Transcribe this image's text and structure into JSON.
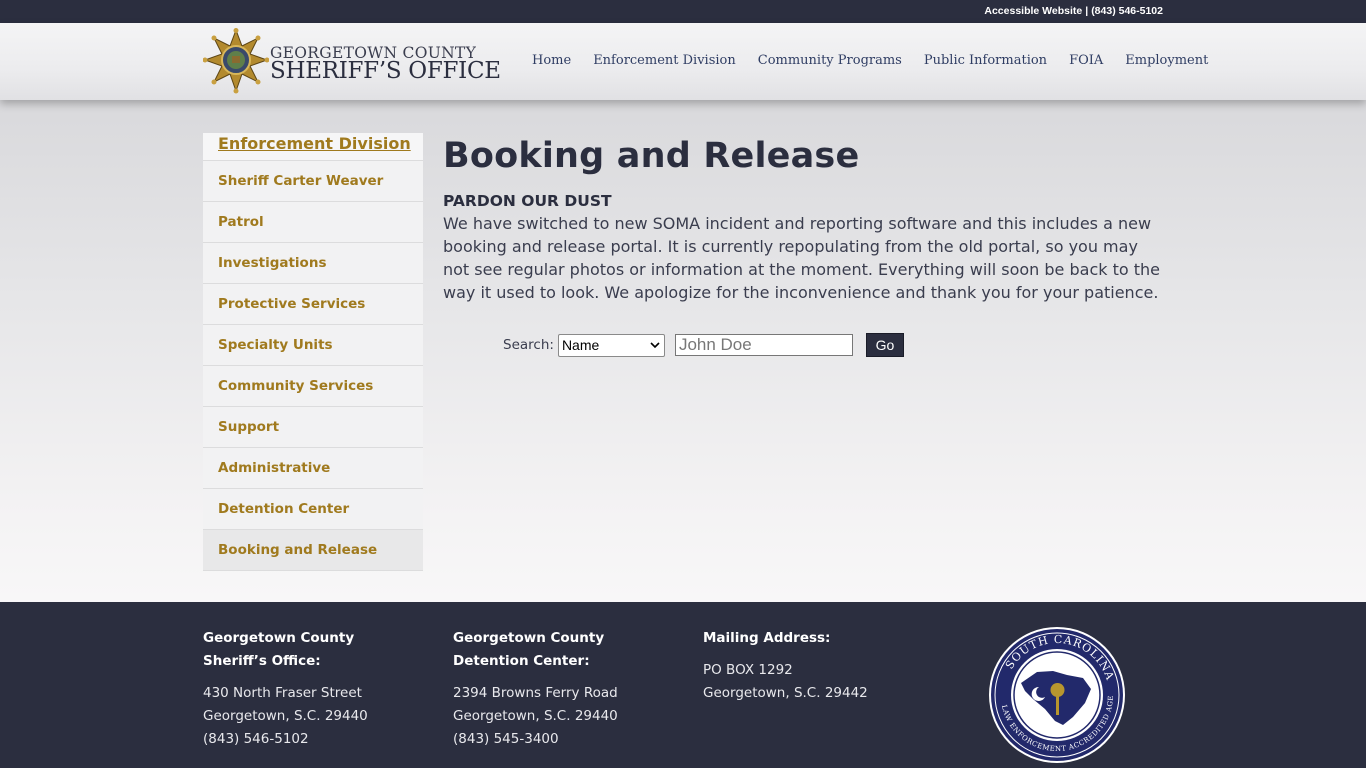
{
  "topbar": {
    "accessible": "Accessible Website",
    "separator": "|",
    "phone": "(843) 546-5102"
  },
  "header": {
    "logo_line1": "GEORGETOWN COUNTY",
    "logo_line2": "SHERIFF’S OFFICE",
    "logo_icon": "sheriff-star-badge",
    "nav": [
      "Home",
      "Enforcement Division",
      "Community Programs",
      "Public Information",
      "FOIA",
      "Employment"
    ]
  },
  "sidebar": {
    "title": "Enforcement Division",
    "items": [
      "Sheriff Carter Weaver",
      "Patrol",
      "Investigations",
      "Protective Services",
      "Specialty Units",
      "Community Services",
      "Support",
      "Administrative",
      "Detention Center",
      "Booking and Release"
    ],
    "active_item": "Booking and Release"
  },
  "main": {
    "title": "Booking and Release",
    "notice_heading": "PARDON OUR DUST",
    "notice_body": "We have switched to new SOMA incident and reporting software and this includes a new booking and release portal. It is currently repopulating from the old portal, so you may not see regular photos or information at the moment. Everything will soon be back to the way it used to look. We apologize for the inconvenience and thank you for your patience."
  },
  "search": {
    "label": "Search:",
    "select_value": "Name",
    "input_placeholder": "John Doe",
    "button": "Go"
  },
  "footer": {
    "office": {
      "heading": "Georgetown County Sheriff’s Office:",
      "line1": "430 North Fraser Street",
      "line2": "Georgetown, S.C. 29440",
      "line3": "(843) 546-5102"
    },
    "detention": {
      "heading": "Georgetown County Detention Center:",
      "line1": "2394 Browns Ferry Road",
      "line2": "Georgetown, S.C. 29440",
      "line3": "(843) 545-3400"
    },
    "mailing": {
      "heading": "Mailing Address:",
      "line1": "PO BOX 1292",
      "line2": "Georgetown, S.C. 29442"
    },
    "seal_text": "SOUTH CAROLINA LAW ENFORCEMENT ACCREDITED AGENCY"
  },
  "colors": {
    "dark": "#2b2e3f",
    "gold": "#a07a1e",
    "nav": "#2f3d63"
  }
}
